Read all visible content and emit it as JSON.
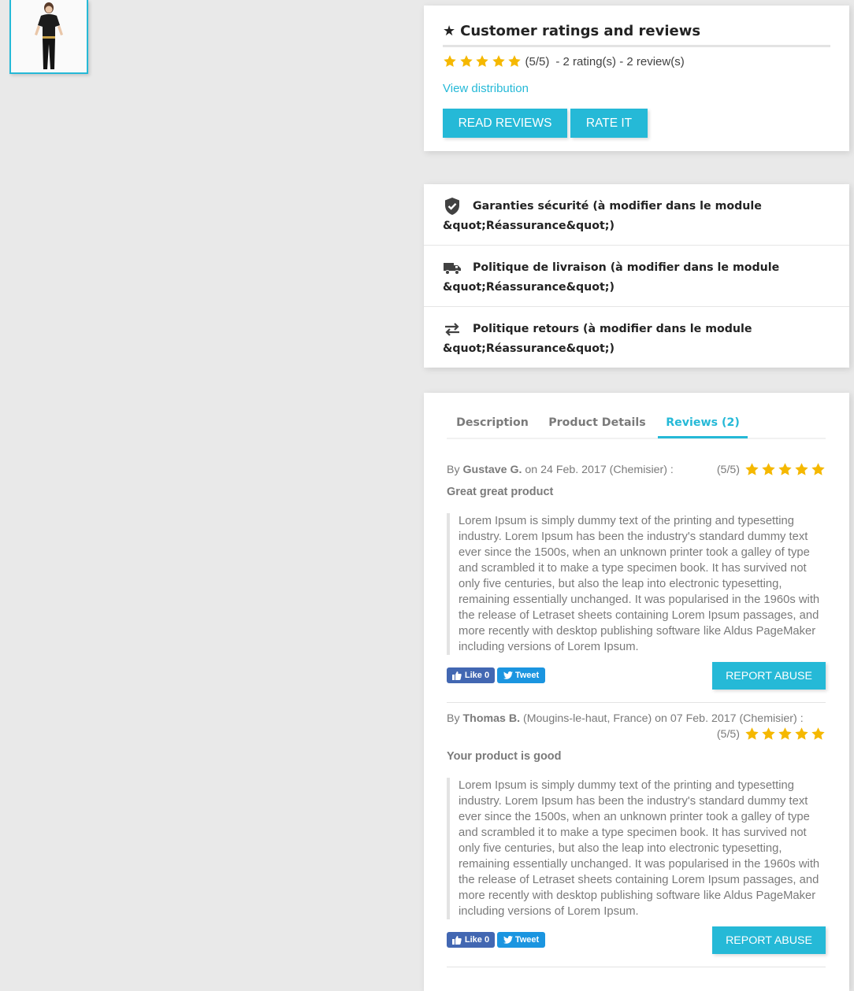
{
  "colors": {
    "accent": "#25b9d7",
    "star": "#f5b800",
    "background": "#e9e9e9"
  },
  "thumbnail": {
    "alt_icon": "product-thumbnail-dress"
  },
  "ratings": {
    "title": "Customer ratings and reviews",
    "title_icon": "star-icon",
    "stars": 5,
    "score": "(5/5)",
    "counts": "- 2 rating(s) - 2 review(s)",
    "view_distribution": "View distribution",
    "read_reviews": "READ REVIEWS",
    "rate_it": "RATE IT"
  },
  "reassurance": [
    {
      "icon": "shield-check-icon",
      "text": "Garanties sécurité (à modifier dans le module &quot;Réassurance&quot;)"
    },
    {
      "icon": "truck-icon",
      "text": "Politique de livraison (à modifier dans le module &quot;Réassurance&quot;)"
    },
    {
      "icon": "swap-arrows-icon",
      "text": "Politique retours (à modifier dans le module &quot;Réassurance&quot;)"
    }
  ],
  "tabs": [
    {
      "label": "Description",
      "active": false
    },
    {
      "label": "Product Details",
      "active": false
    },
    {
      "label": "Reviews (2)",
      "active": true
    }
  ],
  "reviews": [
    {
      "by": "By",
      "author": "Gustave G.",
      "location": "",
      "rest": "on 24 Feb. 2017 (Chemisier) :",
      "score": "(5/5)",
      "stars": 5,
      "title": "Great great product",
      "body": "Lorem Ipsum is simply dummy text of the printing and typesetting industry. Lorem Ipsum has been the industry's standard dummy text ever since the 1500s, when an unknown printer took a galley of type and scrambled it to make a type specimen book. It has survived not only five centuries, but also the leap into electronic typesetting, remaining essentially unchanged. It was popularised in the 1960s with the release of Letraset sheets containing Lorem Ipsum passages, and more recently with desktop publishing software like Aldus PageMaker including versions of Lorem Ipsum.",
      "like": "Like 0",
      "tweet": "Tweet",
      "report": "REPORT ABUSE"
    },
    {
      "by": "By",
      "author": "Thomas B.",
      "location": "(Mougins-le-haut, France)",
      "rest": "on 07 Feb. 2017 (Chemisier) :",
      "score": "(5/5)",
      "stars": 5,
      "title": "Your product is good",
      "body": "Lorem Ipsum is simply dummy text of the printing and typesetting industry. Lorem Ipsum has been the industry's standard dummy text ever since the 1500s, when an unknown printer took a galley of type and scrambled it to make a type specimen book. It has survived not only five centuries, but also the leap into electronic typesetting, remaining essentially unchanged. It was popularised in the 1960s with the release of Letraset sheets containing Lorem Ipsum passages, and more recently with desktop publishing software like Aldus PageMaker including versions of Lorem Ipsum.",
      "like": "Like 0",
      "tweet": "Tweet",
      "report": "REPORT ABUSE"
    }
  ]
}
